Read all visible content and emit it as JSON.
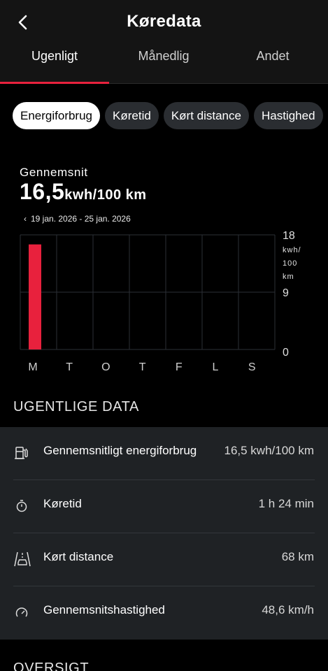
{
  "header": {
    "title": "Køredata"
  },
  "tabs": [
    {
      "label": "Ugenligt",
      "active": true
    },
    {
      "label": "Månedlig",
      "active": false
    },
    {
      "label": "Andet",
      "active": false
    }
  ],
  "chips": [
    {
      "label": "Energiforbrug",
      "active": true
    },
    {
      "label": "Køretid",
      "active": false
    },
    {
      "label": "Kørt distance",
      "active": false
    },
    {
      "label": "Hastighed",
      "active": false
    }
  ],
  "summary": {
    "label": "Gennemsnit",
    "value": "16,5",
    "unit": "kwh/100 km"
  },
  "range": {
    "text": "19 jan. 2026 - 25 jan. 2026"
  },
  "colors": {
    "accent": "#e8213d",
    "panel": "#1f2225",
    "chip": "#2a2d31"
  },
  "chart_data": {
    "type": "bar",
    "categories": [
      "M",
      "T",
      "O",
      "T",
      "F",
      "L",
      "S"
    ],
    "values": [
      16.5,
      0,
      0,
      0,
      0,
      0,
      0
    ],
    "ylim": [
      0,
      18
    ],
    "yticks": [
      "0",
      "9",
      "18"
    ],
    "yunit": [
      "kwh/",
      "100",
      "km"
    ],
    "grid": true
  },
  "weekly": {
    "title": "UGENTLIGE DATA",
    "rows": [
      {
        "icon": "charging-station-icon",
        "label": "Gennemsnitligt energiforbrug",
        "value": "16,5 kwh/100 km"
      },
      {
        "icon": "stopwatch-icon",
        "label": "Køretid",
        "value": "1 h 24 min"
      },
      {
        "icon": "road-car-icon",
        "label": "Kørt distance",
        "value": "68 km"
      },
      {
        "icon": "speedometer-icon",
        "label": "Gennemsnitshastighed",
        "value": "48,6 km/h"
      }
    ]
  },
  "overview": {
    "title": "OVERSIGT"
  }
}
